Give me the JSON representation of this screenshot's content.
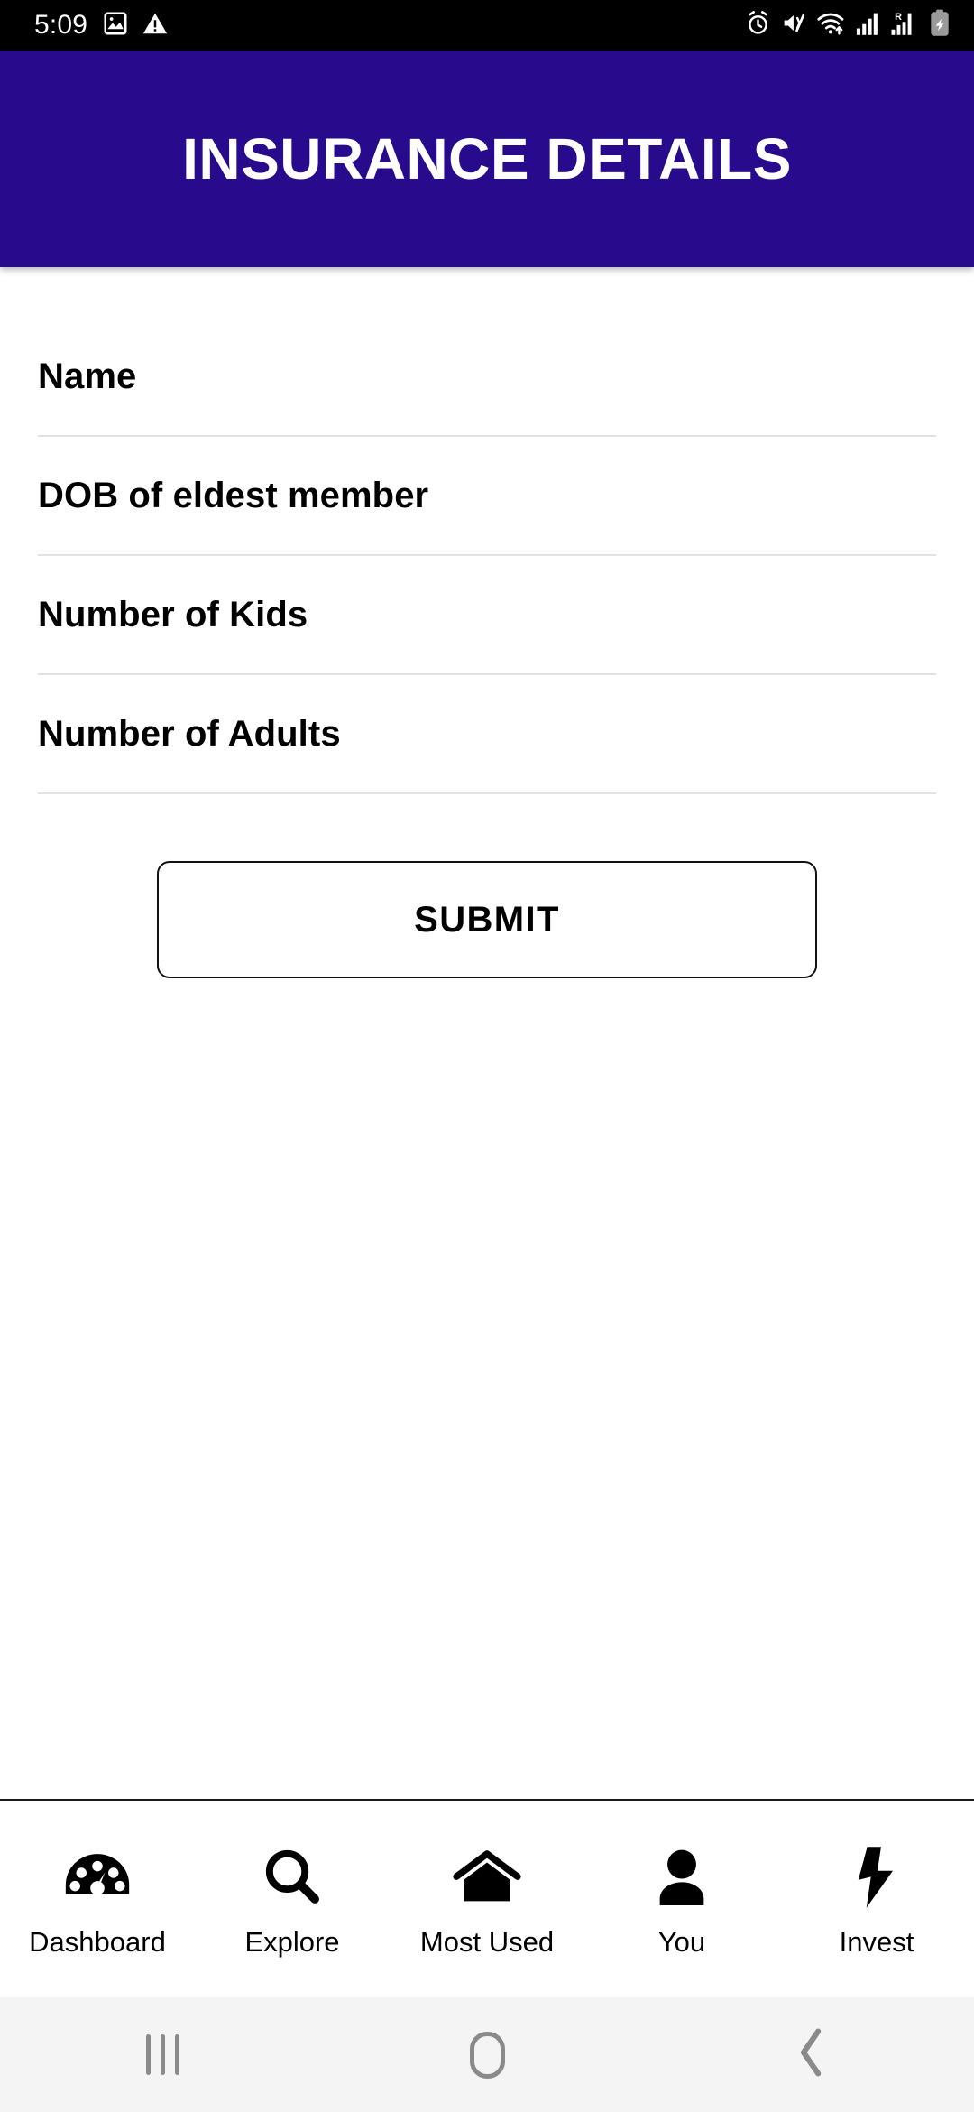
{
  "status_bar": {
    "time": "5:09",
    "left_icons": [
      "image-icon",
      "warning-triangle-icon"
    ],
    "right_icons": [
      "alarm-clock-icon",
      "mute-vibrate-icon",
      "wifi-icon",
      "signal-bars-icon",
      "roaming-signal-icon",
      "battery-charging-icon"
    ],
    "roaming_label": "R",
    "background": "#000000"
  },
  "header": {
    "title": "INSURANCE DETAILS",
    "background": "#280A8C",
    "text_color": "#FFFFFF"
  },
  "form": {
    "fields": [
      {
        "label": "Name",
        "value": "",
        "placeholder": ""
      },
      {
        "label": "DOB of eldest member",
        "value": "",
        "placeholder": ""
      },
      {
        "label": "Number of Kids",
        "value": "",
        "placeholder": ""
      },
      {
        "label": "Number of Adults",
        "value": "",
        "placeholder": ""
      }
    ],
    "submit_label": "SUBMIT",
    "divider_color": "#E2E2E2"
  },
  "bottom_nav": {
    "items": [
      {
        "label": "Dashboard",
        "icon": "speedometer-icon"
      },
      {
        "label": "Explore",
        "icon": "search-icon"
      },
      {
        "label": "Most Used",
        "icon": "home-icon"
      },
      {
        "label": "You",
        "icon": "person-icon"
      },
      {
        "label": "Invest",
        "icon": "lightning-bolt-icon"
      }
    ]
  },
  "system_nav": {
    "buttons": [
      {
        "name": "recents",
        "icon": "recents-icon"
      },
      {
        "name": "home",
        "icon": "home-pill-icon"
      },
      {
        "name": "back",
        "icon": "chevron-left-icon"
      }
    ],
    "background": "#F4F4F4",
    "icon_color": "#8A8A8A"
  }
}
